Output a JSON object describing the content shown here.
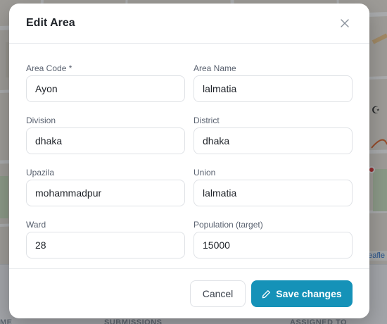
{
  "modal": {
    "title": "Edit Area",
    "close_icon": "close-icon"
  },
  "form": {
    "fields": [
      {
        "label": "Area Code *",
        "value": "Ayon"
      },
      {
        "label": "Area Name",
        "value": "lalmatia"
      },
      {
        "label": "Division",
        "value": "dhaka"
      },
      {
        "label": "District",
        "value": "dhaka"
      },
      {
        "label": "Upazila",
        "value": "mohammadpur"
      },
      {
        "label": "Union",
        "value": "lalmatia"
      },
      {
        "label": "Ward",
        "value": "28"
      },
      {
        "label": "Population (target)",
        "value": "15000"
      }
    ]
  },
  "footer": {
    "cancel_label": "Cancel",
    "save_label": "Save changes",
    "save_icon": "pencil-icon"
  },
  "background": {
    "map_attribution": "Leafle",
    "table_headers": [
      "ME",
      "SUBMISSIONS",
      "ASSIGNED TO"
    ]
  },
  "colors": {
    "primary": "#1592b8",
    "overlay": "#1e2228",
    "text": "#1f2329"
  }
}
